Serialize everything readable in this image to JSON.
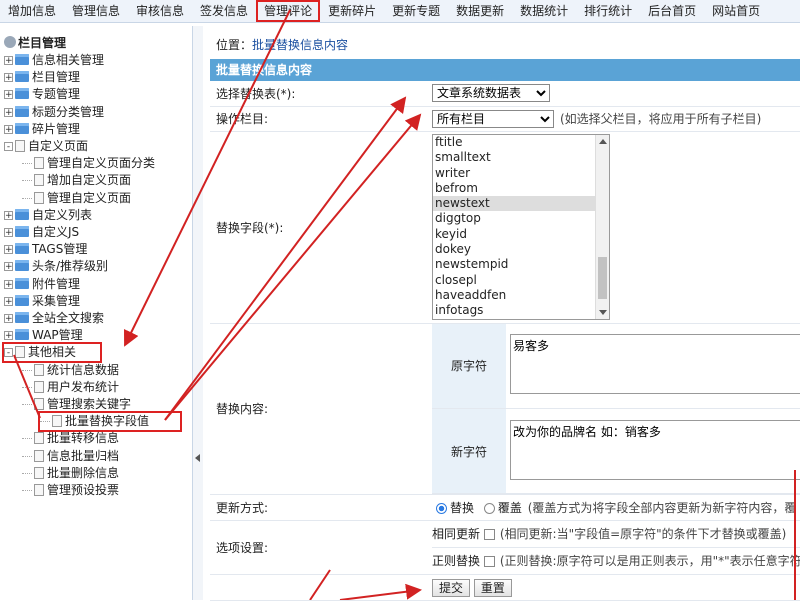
{
  "topnav": [
    "增加信息",
    "管理信息",
    "审核信息",
    "签发信息",
    "管理评论",
    "更新碎片",
    "更新专题",
    "数据更新",
    "数据统计",
    "排行统计",
    "后台首页",
    "网站首页"
  ],
  "sidebar": {
    "title": "栏目管理",
    "items": [
      {
        "label": "信息相关管理",
        "kind": "folder",
        "expand": "+"
      },
      {
        "label": "栏目管理",
        "kind": "folder",
        "expand": "+"
      },
      {
        "label": "专题管理",
        "kind": "folder",
        "expand": "+"
      },
      {
        "label": "标题分类管理",
        "kind": "folder",
        "expand": "+"
      },
      {
        "label": "碎片管理",
        "kind": "folder",
        "expand": "+"
      },
      {
        "label": "自定义页面",
        "kind": "doc-open",
        "expand": "-"
      },
      {
        "label": "管理自定义页面分类",
        "kind": "child"
      },
      {
        "label": "增加自定义页面",
        "kind": "child"
      },
      {
        "label": "管理自定义页面",
        "kind": "child"
      },
      {
        "label": "自定义列表",
        "kind": "folder",
        "expand": "+"
      },
      {
        "label": "自定义JS",
        "kind": "folder",
        "expand": "+"
      },
      {
        "label": "TAGS管理",
        "kind": "folder",
        "expand": "+"
      },
      {
        "label": "头条/推荐级别",
        "kind": "folder",
        "expand": "+"
      },
      {
        "label": "附件管理",
        "kind": "folder",
        "expand": "+"
      },
      {
        "label": "采集管理",
        "kind": "folder",
        "expand": "+"
      },
      {
        "label": "全站全文搜索",
        "kind": "folder",
        "expand": "+"
      },
      {
        "label": "WAP管理",
        "kind": "folder",
        "expand": "+"
      },
      {
        "label": "其他相关",
        "kind": "doc-open",
        "expand": "-"
      },
      {
        "label": "统计信息数据",
        "kind": "child"
      },
      {
        "label": "用户发布统计",
        "kind": "child"
      },
      {
        "label": "管理搜索关键字",
        "kind": "child"
      },
      {
        "label": "批量替换字段值",
        "kind": "child"
      },
      {
        "label": "批量转移信息",
        "kind": "child"
      },
      {
        "label": "信息批量归档",
        "kind": "child"
      },
      {
        "label": "批量删除信息",
        "kind": "child"
      },
      {
        "label": "管理预设投票",
        "kind": "child"
      }
    ]
  },
  "main": {
    "breadcrumb_prefix": "位置：",
    "breadcrumb_link": "批量替换信息内容",
    "panel_title": "批量替换信息内容",
    "table_label": "选择替换表(*):",
    "table_value": "文章系统数据表",
    "column_label": "操作栏目:",
    "column_value": "所有栏目",
    "column_hint": "(如选择父栏目，将应用于所有子栏目)",
    "field_label": "替换字段(*):",
    "fields": [
      "ftitle",
      "smalltext",
      "writer",
      "befrom",
      "newstext",
      "diggtop",
      "keyid",
      "dokey",
      "newstempid",
      "closepl",
      "haveaddfen",
      "infotags"
    ],
    "selected_field": "newstext",
    "content_label": "替换内容:",
    "orig_label": "原字符",
    "orig_value": "易客多",
    "new_label": "新字符",
    "new_value": "改为你的品牌名 如：销客多",
    "mode_label": "更新方式:",
    "mode_replace": "替换",
    "mode_cover": "覆盖",
    "mode_hint": "(覆盖方式为将字段全部内容更新为新字符内容，覆",
    "options_label": "选项设置:",
    "opt1_label": "相同更新",
    "opt1_hint": "(相同更新:当\"字段值=原字符\"的条件下才替换或覆盖)",
    "opt2_label": "正则替换",
    "opt2_hint": "(正则替换:原字符可以是用正则表示，用\"*\"表示任意字符",
    "submit": "提交",
    "reset": "重置"
  },
  "colors": {
    "accent": "#5aa3d6",
    "annotation": "#d22222"
  }
}
